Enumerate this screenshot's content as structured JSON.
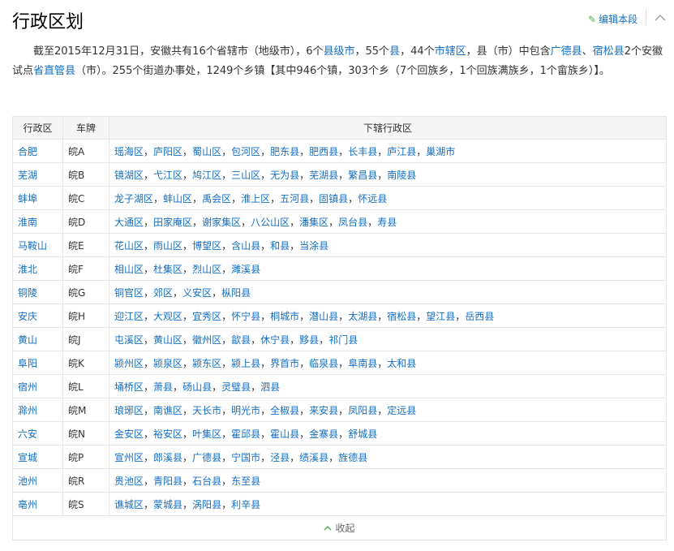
{
  "header": {
    "title": "行政区划",
    "edit_label": "编辑本段"
  },
  "intro": {
    "t1": "截至2015年12月31日，安徽共有16个省辖市（地级市），6个",
    "l1": "县级市",
    "t2": "，55个",
    "l2": "县",
    "t3": "，44个",
    "l3": "市辖区",
    "t4": "，县（市）中包含",
    "l4": "广德县",
    "t5": "、",
    "l5": "宿松县",
    "t6": "2个安徽试点",
    "l6": "省直管县",
    "t7": "（市）。255个街道办事处，1249个乡镇【其中946个镇，303个乡（7个回族乡，1个回族满族乡，1个畲族乡）】。"
  },
  "table": {
    "headers": [
      "行政区",
      "车牌",
      "下辖行政区"
    ],
    "rows": [
      {
        "city": "合肥",
        "plate": "皖A",
        "districts": [
          "瑶海区",
          "庐阳区",
          "蜀山区",
          "包河区",
          "肥东县",
          "肥西县",
          "长丰县",
          "庐江县",
          "巢湖市"
        ]
      },
      {
        "city": "芜湖",
        "plate": "皖B",
        "districts": [
          "镜湖区",
          "弋江区",
          "鸠江区",
          "三山区",
          "无为县",
          "芜湖县",
          "繁昌县",
          "南陵县"
        ]
      },
      {
        "city": "蚌埠",
        "plate": "皖C",
        "districts": [
          "龙子湖区",
          "蚌山区",
          "禹会区",
          "淮上区",
          "五河县",
          "固镇县",
          "怀远县"
        ]
      },
      {
        "city": "淮南",
        "plate": "皖D",
        "districts": [
          "大通区",
          "田家庵区",
          "谢家集区",
          "八公山区",
          "潘集区",
          "凤台县",
          "寿县"
        ]
      },
      {
        "city": "马鞍山",
        "plate": "皖E",
        "districts": [
          "花山区",
          "雨山区",
          "博望区",
          "含山县",
          "和县",
          "当涂县"
        ]
      },
      {
        "city": "淮北",
        "plate": "皖F",
        "districts": [
          "相山区",
          "杜集区",
          "烈山区",
          "濉溪县"
        ]
      },
      {
        "city": "铜陵",
        "plate": "皖G",
        "districts": [
          "铜官区",
          "郊区",
          "义安区",
          "枞阳县"
        ]
      },
      {
        "city": "安庆",
        "plate": "皖H",
        "districts": [
          "迎江区",
          "大观区",
          "宜秀区",
          "怀宁县",
          "桐城市",
          "潜山县",
          "太湖县",
          "宿松县",
          "望江县",
          "岳西县"
        ]
      },
      {
        "city": "黄山",
        "plate": "皖J",
        "districts": [
          "屯溪区",
          "黄山区",
          "徽州区",
          "歙县",
          "休宁县",
          "黟县",
          "祁门县"
        ]
      },
      {
        "city": "阜阳",
        "plate": "皖K",
        "districts": [
          "颍州区",
          "颍泉区",
          "颍东区",
          "颍上县",
          "界首市",
          "临泉县",
          "阜南县",
          "太和县"
        ]
      },
      {
        "city": "宿州",
        "plate": "皖L",
        "districts": [
          "埇桥区",
          "萧县",
          "砀山县",
          "灵璧县",
          "泗县"
        ]
      },
      {
        "city": "滁州",
        "plate": "皖M",
        "districts": [
          "琅琊区",
          "南谯区",
          "天长市",
          "明光市",
          "全椒县",
          "来安县",
          "凤阳县",
          "定远县"
        ]
      },
      {
        "city": "六安",
        "plate": "皖N",
        "districts": [
          "金安区",
          "裕安区",
          "叶集区",
          "霍邱县",
          "霍山县",
          "金寨县",
          "舒城县"
        ]
      },
      {
        "city": "宣城",
        "plate": "皖P",
        "districts": [
          "宣州区",
          "郎溪县",
          "广德县",
          "宁国市",
          "泾县",
          "绩溪县",
          "旌德县"
        ]
      },
      {
        "city": "池州",
        "plate": "皖R",
        "districts": [
          "贵池区",
          "青阳县",
          "石台县",
          "东至县"
        ]
      },
      {
        "city": "亳州",
        "plate": "皖S",
        "districts": [
          "谯城区",
          "蒙城县",
          "涡阳县",
          "利辛县"
        ]
      }
    ]
  },
  "footer": {
    "collapse_label": "收起"
  },
  "colors": {
    "link": "#136ec2",
    "edit_icon": "#4caf50"
  }
}
